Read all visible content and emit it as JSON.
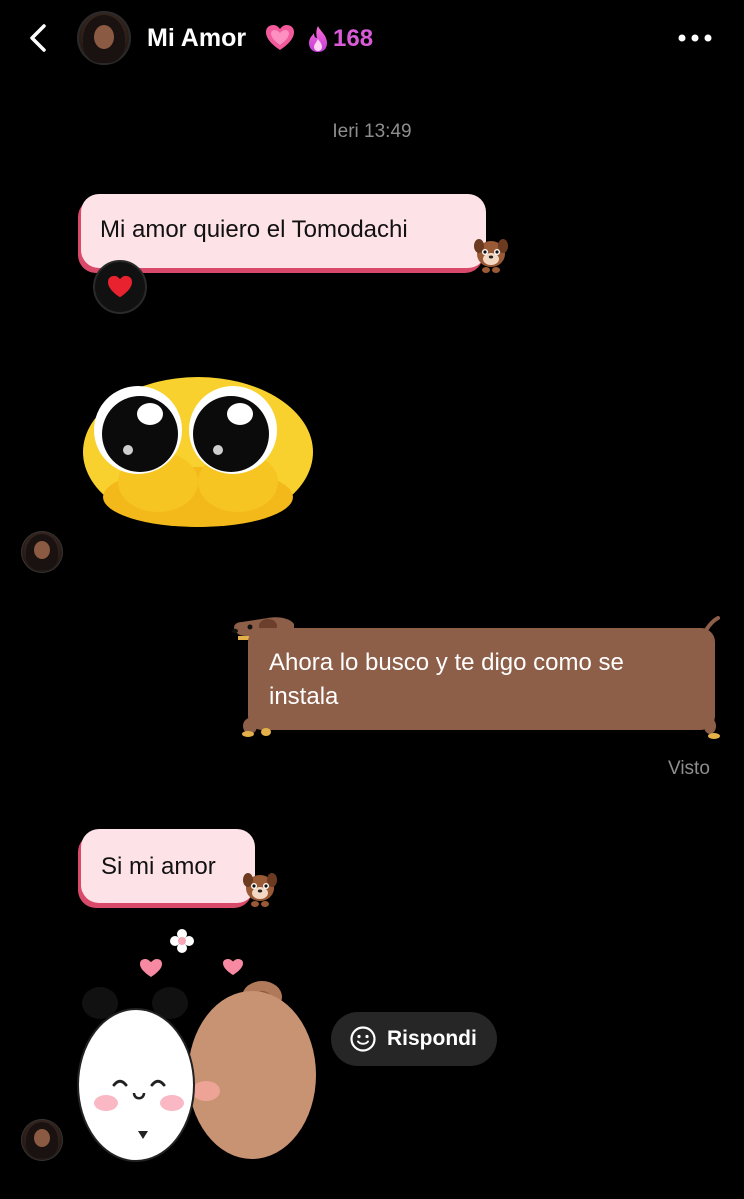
{
  "header": {
    "title": "Mi Amor",
    "title_emoji": "heart-emoji",
    "streak_icon": "flame-icon",
    "streak_count": "168",
    "streak_color": "#d85bd8"
  },
  "conversation": {
    "timestamp": "Ieri 13:49",
    "messages": [
      {
        "from": "them",
        "text": "Mi amor quiero el Tomodachi",
        "reaction": "red-heart"
      },
      {
        "from": "them",
        "sticker": "pleading-face-sticker"
      },
      {
        "from": "me",
        "text": "Ahora lo busco y te digo como se instala",
        "status": "Visto"
      },
      {
        "from": "them",
        "text": "Si mi amor"
      },
      {
        "from": "them",
        "sticker": "panda-bear-hug-sticker"
      }
    ]
  },
  "actions": {
    "reply_label": "Rispondi"
  },
  "colors": {
    "background": "#000000",
    "incoming_bubble": "#fde2e8",
    "incoming_bubble_edge": "#d94a6a",
    "outgoing_bubble": "#8d5e48",
    "muted_text": "#8e8e8e"
  }
}
